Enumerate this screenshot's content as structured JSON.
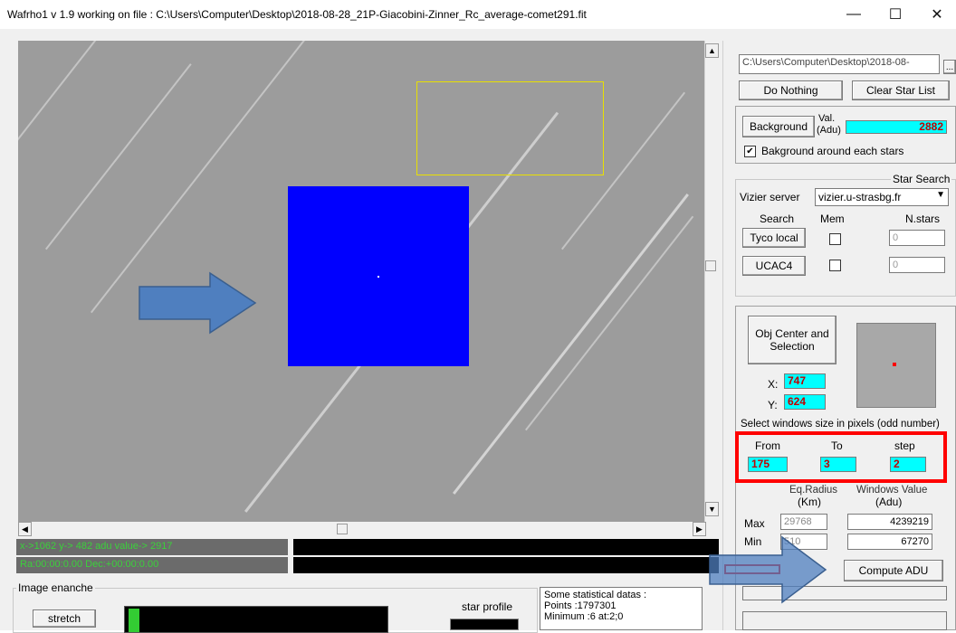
{
  "window": {
    "title": "Wafrho1 v 1.9 working on file : C:\\Users\\Computer\\Desktop\\2018-08-28_21P-Giacobini-Zinner_Rc_average-comet291.fit",
    "minimize": "—",
    "maximize": "☐",
    "close": "✕"
  },
  "status": {
    "coords": "x->1062 y-> 482 adu value->     2917",
    "radec": "Ra:00:00:0.00 Dec:+00:00:0.00"
  },
  "file_panel": {
    "path": "C:\\Users\\Computer\\Desktop\\2018-08-",
    "browse": "...",
    "do_nothing": "Do Nothing",
    "clear_star_list": "Clear Star List"
  },
  "background_panel": {
    "button": "Background",
    "val_label": "Val.",
    "adu_label": "(Adu)",
    "value": "2882",
    "checkbox_label": "Bakground around each stars",
    "checked": true
  },
  "star_search": {
    "title": "Star Search",
    "vizier_label": "Vizier server",
    "vizier_value": "vizier.u-strasbg.fr",
    "search_header": "Search",
    "mem_header": "Mem",
    "nstars_header": "N.stars",
    "tyco_button": "Tyco local",
    "tyco_count": "0",
    "ucac_button": "UCAC4",
    "ucac_count": "0"
  },
  "obj_panel": {
    "center_button": "Obj Center and Selection",
    "x_label": "X:",
    "x_value": "747",
    "y_label": "Y:",
    "y_value": "624",
    "window_size_label": "Select windows size in pixels (odd number)",
    "from_label": "From",
    "to_label": "To",
    "step_label": "step",
    "from_value": "175",
    "to_value": "3",
    "step_value": "2",
    "eq_radius_label": "Eq.Radius",
    "km_label": "(Km)",
    "windows_value_label": "Windows Value",
    "adu_label": "(Adu)",
    "max_label": "Max",
    "min_label": "Min",
    "max_radius": "29768",
    "min_radius": "510",
    "max_adu": "4239219",
    "min_adu": "67270",
    "compute_button": "Compute ADU"
  },
  "bottom": {
    "image_enhance_title": "Image enanche",
    "stretch_button": "stretch",
    "star_profile_label": "star profile",
    "stats_title": "Some statistical datas :",
    "stats_points": "Points :1797301",
    "stats_minimum": "Minimum :6 at:2;0"
  },
  "colors": {
    "selection_blue": "#0000ff",
    "highlight_red": "#ff0000",
    "value_cyan": "#00ffff",
    "arrow_blue": "#4f7fbf",
    "status_green": "#3bd13b"
  }
}
